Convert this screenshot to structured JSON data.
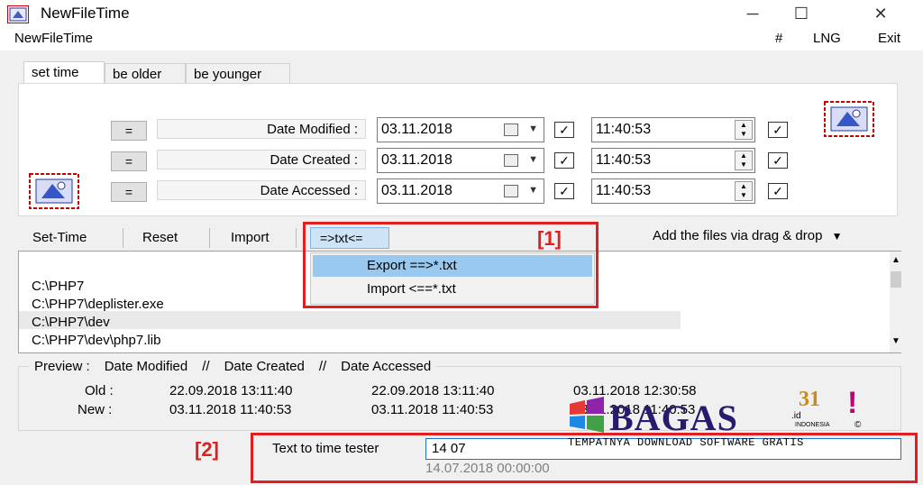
{
  "window": {
    "title": "NewFileTime",
    "minimize": "─",
    "maximize": "☐",
    "close": "✕"
  },
  "menu": {
    "app": "NewFileTime",
    "hash": "#",
    "lng": "LNG",
    "exit": "Exit"
  },
  "tabs": [
    {
      "label": "set time"
    },
    {
      "label": "be older"
    },
    {
      "label": "be younger"
    }
  ],
  "rows": [
    {
      "eq": "=",
      "label": "Date Modified :",
      "date": "03.11.2018",
      "time": "11:40:53"
    },
    {
      "eq": "=",
      "label": "Date Created :",
      "date": "03.11.2018",
      "time": "11:40:53"
    },
    {
      "eq": "=",
      "label": "Date Accessed :",
      "date": "03.11.2018",
      "time": "11:40:53"
    }
  ],
  "toolbar": {
    "set_time": "Set-Time",
    "reset": "Reset",
    "import": "Import",
    "txt": "=>txt<=",
    "drag_drop": "Add the files via drag & drop"
  },
  "dropdown": {
    "export": "Export ==>*.txt",
    "import": "Import <==*.txt"
  },
  "files": [
    "C:\\PHP7",
    "C:\\PHP7\\deplister.exe",
    "C:\\PHP7\\dev",
    "C:\\PHP7\\dev\\php7.lib"
  ],
  "preview": {
    "header": [
      "Preview  :",
      "Date Modified",
      "//",
      "Date Created",
      "//",
      "Date Accessed"
    ],
    "old_label": "Old :",
    "new_label": "New :",
    "old": [
      "22.09.2018 13:11:40",
      "22.09.2018 13:11:40",
      "03.11.2018 12:30:58"
    ],
    "new": [
      "03.11.2018 11:40:53",
      "03.11.2018 11:40:53",
      "03.11.2018 11:40:53"
    ]
  },
  "tester": {
    "label": "Text to time tester",
    "value": "14 07",
    "result": "14.07.2018 00:00:00"
  },
  "annotations": {
    "one": "[1]",
    "two": "[2]"
  },
  "watermark": {
    "brand": "BAGAS",
    "num": "31",
    "tld": ".id",
    "country": "INDONESIA",
    "tagline": "TEMPATNYA DOWNLOAD SOFTWARE GRATIS"
  },
  "colors": {
    "accent": "#e02020",
    "selection": "#99c9ef",
    "brand": "#2a1a6e"
  }
}
